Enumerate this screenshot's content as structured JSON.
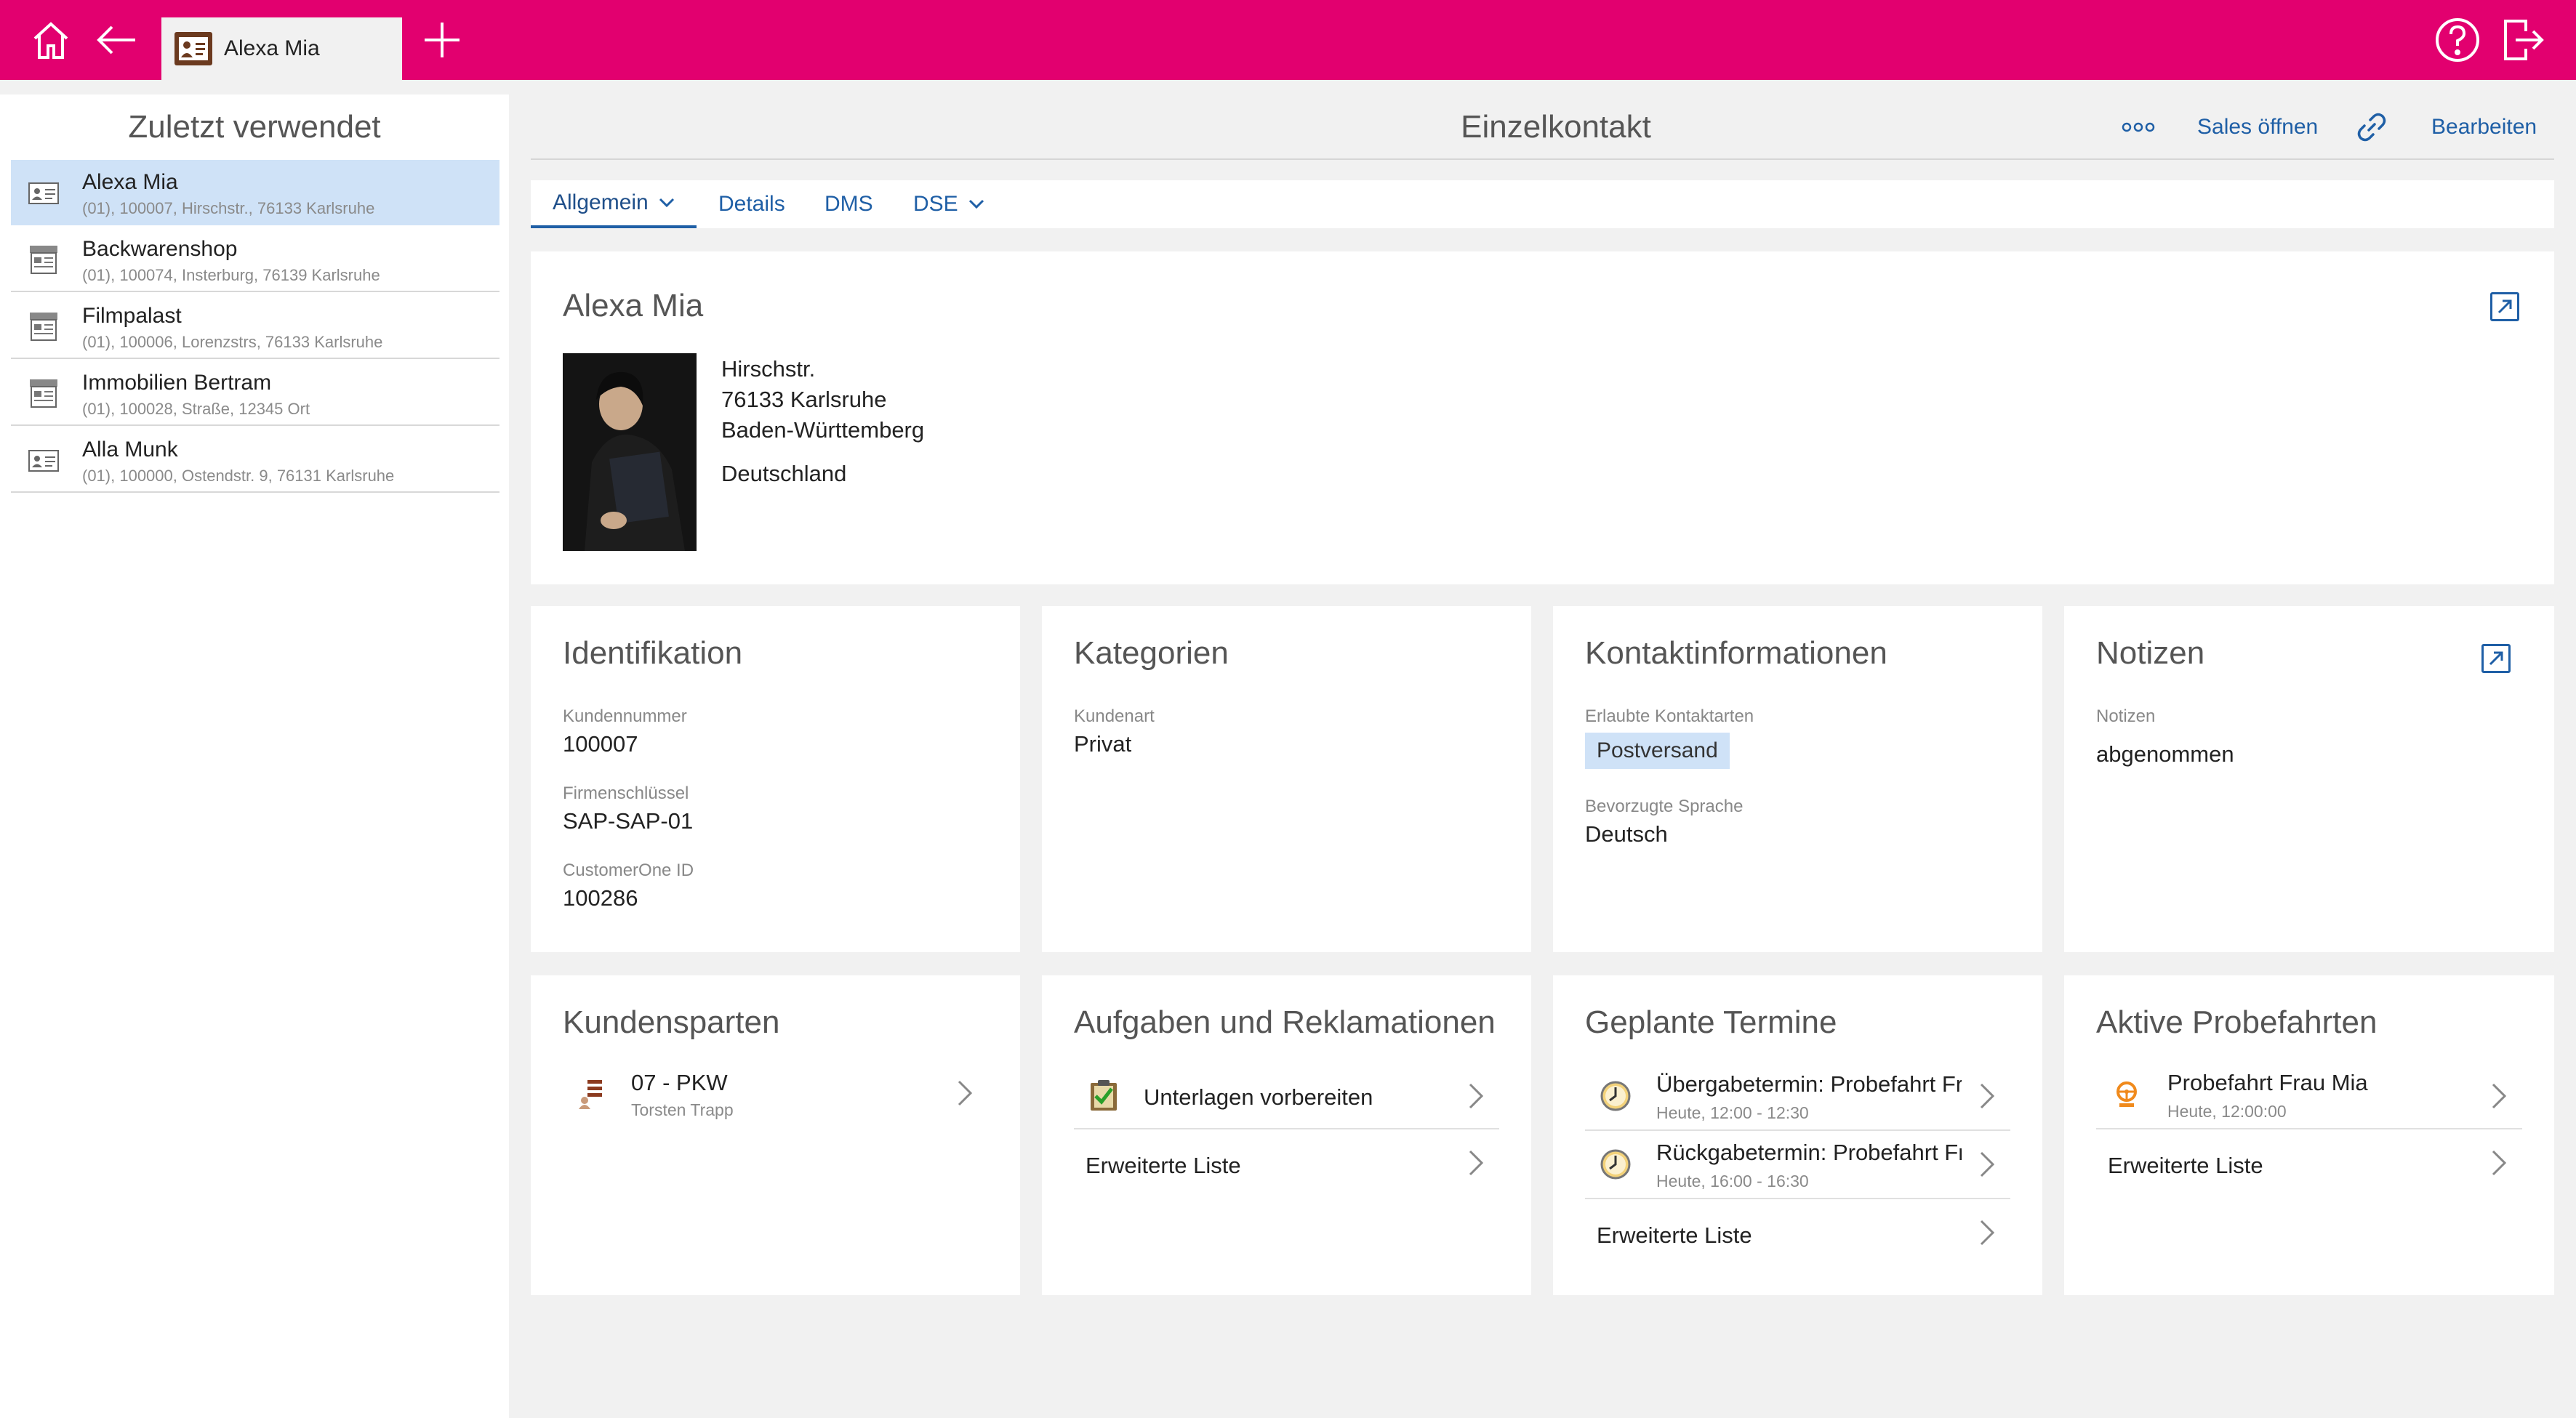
{
  "topbar": {
    "tab_label": "Alexa Mia"
  },
  "recent": {
    "title": "Zuletzt verwendet",
    "items": [
      {
        "name": "Alexa Mia",
        "sub": "(01), 100007, Hirschstr., 76133 Karlsruhe"
      },
      {
        "name": "Backwarenshop",
        "sub": "(01), 100074, Insterburg, 76139 Karlsruhe"
      },
      {
        "name": "Filmpalast",
        "sub": "(01), 100006, Lorenzstrs, 76133 Karlsruhe"
      },
      {
        "name": "Immobilien Bertram",
        "sub": "(01), 100028, Straße, 12345 Ort"
      },
      {
        "name": "Alla Munk",
        "sub": "(01), 100000, Ostendstr. 9, 76131 Karlsruhe"
      }
    ]
  },
  "header": {
    "title": "Einzelkontakt",
    "more_label": "ooo",
    "sales_label": "Sales öffnen",
    "edit_label": "Bearbeiten"
  },
  "tabs": [
    "Allgemein",
    "Details",
    "DMS",
    "DSE"
  ],
  "contact": {
    "name": "Alexa Mia",
    "street": "Hirschstr.",
    "city": "76133 Karlsruhe",
    "state": "Baden-Württemberg",
    "country": "Deutschland"
  },
  "identification": {
    "title": "Identifikation",
    "fields": [
      {
        "label": "Kundennummer",
        "value": "100007"
      },
      {
        "label": "Firmenschlüssel",
        "value": "SAP-SAP-01"
      },
      {
        "label": "CustomerOne ID",
        "value": "100286"
      }
    ]
  },
  "categories": {
    "title": "Kategorien",
    "label": "Kundenart",
    "value": "Privat"
  },
  "contactinfo": {
    "title": "Kontaktinformationen",
    "allowed_label": "Erlaubte Kontaktarten",
    "allowed_value": "Postversand",
    "language_label": "Bevorzugte Sprache",
    "language_value": "Deutsch"
  },
  "notes": {
    "title": "Notizen",
    "label": "Notizen",
    "value": "abgenommen"
  },
  "divisions": {
    "title": "Kundensparten",
    "items": [
      {
        "name": "07 - PKW",
        "sub": "Torsten Trapp"
      }
    ]
  },
  "tasks": {
    "title": "Aufgaben und Reklamationen",
    "items": [
      {
        "name": "Unterlagen vorbereiten"
      }
    ],
    "more": "Erweiterte Liste"
  },
  "appointments": {
    "title": "Geplante Termine",
    "items": [
      {
        "name": "Übergabetermin: Probefahrt Fr...",
        "sub": "Heute, 12:00 - 12:30"
      },
      {
        "name": "Rückgabetermin: Probefahrt Fr...",
        "sub": "Heute, 16:00 - 16:30"
      }
    ],
    "more": "Erweiterte Liste"
  },
  "testdrives": {
    "title": "Aktive Probefahrten",
    "items": [
      {
        "name": "Probefahrt Frau Mia",
        "sub": "Heute, 12:00:00"
      }
    ],
    "more": "Erweiterte Liste"
  }
}
